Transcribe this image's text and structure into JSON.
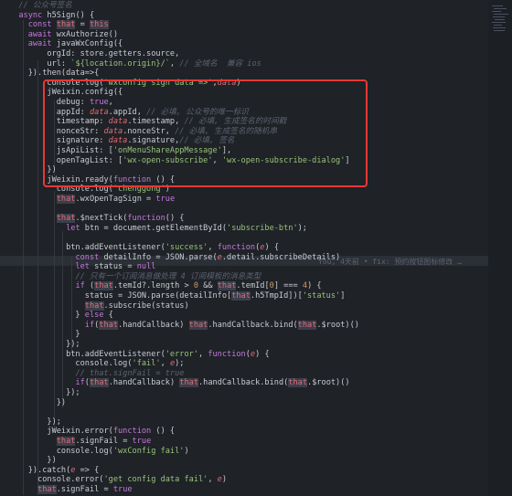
{
  "editor": {
    "lines": [
      "  // 公众号签名",
      "  async h5Sign() {",
      "    const that = this",
      "    await wxAuthorize()",
      "    await javaWxConfig({",
      "        orgId: store.getters.source,",
      "        url: `${location.origin}/`, // 全域名  兼容 ios",
      "    }).then(data=>{",
      "        console.log('wxconfig sign data =>',data)",
      "        jWeixin.config({",
      "          debug: true,",
      "          appId: data.appId, // 必填, 公众号的唯一标识",
      "          timestamp: data.timestamp, // 必填, 生成签名的时间戳",
      "          nonceStr: data.nonceStr, // 必填, 生成签名的随机串",
      "          signature: data.signature,// 必填, 签名",
      "          jsApiList: ['onMenuShareAppMessage'],",
      "          openTagList: ['wx-open-subscribe', 'wx-open-subscribe-dialog']",
      "        })",
      "        jWeixin.ready(function () {",
      "          console.log('chenggong')",
      "          that.wxOpenTagSign = true",
      "",
      "          that.$nextTick(function() {",
      "            let btn = document.getElementById('subscribe-btn');",
      "",
      "            btn.addEventListener('success', function(e) {",
      "              const detailInfo = JSON.parse(e.detail.subscribeDetails)",
      "              let status = null",
      "              // 只有一个订阅消息做处理 4 订阅模板的消息类型",
      "              if (that.temId?.length > 0 && that.temId[0] === 4) {",
      "                status = JSON.parse(detailInfo[that.h5TmpId])['status']",
      "                that.subscribe(status)",
      "              } else {",
      "                if(that.handCallback) that.handCallback.bind(that.$root)()",
      "              }",
      "            });",
      "            btn.addEventListener('error', function(e) {",
      "              console.log('fail', e);",
      "              // that.signFail = true",
      "              if(that.handCallback) that.handCallback.bind(that.$root)()",
      "            });",
      "          })",
      "",
      "        });",
      "        jWeixin.error(function () {",
      "          that.signFail = true",
      "          console.log('wxConfig fail')",
      "        })",
      "    }).catch(e => {",
      "      console.error('get config data fail', e)",
      "      that.signFail = true"
    ],
    "blame_text": "You, 4天前 • fix: 预约按钮图标修改 …"
  }
}
